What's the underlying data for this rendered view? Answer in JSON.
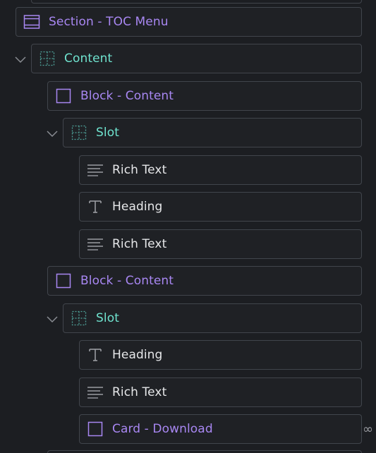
{
  "nodes": [
    {
      "label": "Section - TOC Menu",
      "type": "section"
    },
    {
      "label": "Content",
      "type": "slot"
    },
    {
      "label": "Block - Content",
      "type": "block"
    },
    {
      "label": "Slot",
      "type": "slot"
    },
    {
      "label": "Rich Text",
      "type": "richtext"
    },
    {
      "label": "Heading",
      "type": "heading"
    },
    {
      "label": "Rich Text",
      "type": "richtext"
    },
    {
      "label": "Block - Content",
      "type": "block"
    },
    {
      "label": "Slot",
      "type": "slot"
    },
    {
      "label": "Heading",
      "type": "heading"
    },
    {
      "label": "Rich Text",
      "type": "richtext"
    },
    {
      "label": "Card - Download",
      "type": "block"
    }
  ],
  "overflow_icon": "∞",
  "colors": {
    "component": "#a887f2",
    "slot": "#6fe3cf",
    "element": "#e6e7e9",
    "border": "#41454c",
    "background": "#1c1e22"
  }
}
